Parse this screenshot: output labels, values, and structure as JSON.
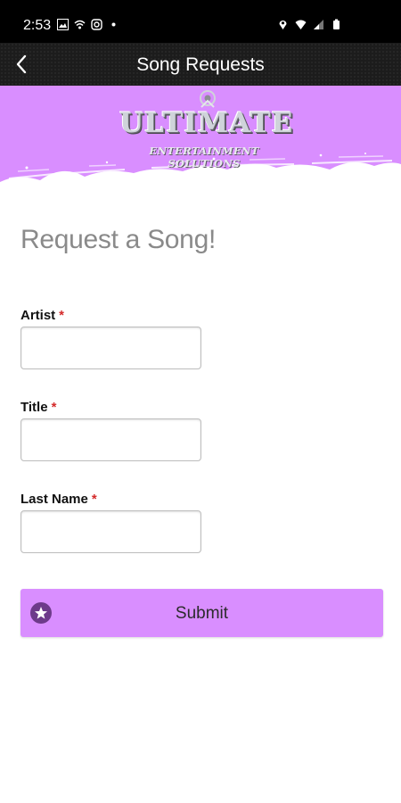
{
  "status_bar": {
    "time": "2:53"
  },
  "header": {
    "title": "Song Requests"
  },
  "banner": {
    "logo_main": "ULTIMATE",
    "logo_sub": "ENTERTAINMENT SOLUTIONS"
  },
  "form": {
    "heading": "Request a Song!",
    "required_marker": "*",
    "fields": [
      {
        "label": "Artist",
        "value": ""
      },
      {
        "label": "Title",
        "value": ""
      },
      {
        "label": "Last Name",
        "value": ""
      }
    ],
    "submit_label": "Submit"
  },
  "colors": {
    "accent": "#d98eff",
    "header_bg": "#1c1c1c",
    "required": "#d42a2a"
  }
}
